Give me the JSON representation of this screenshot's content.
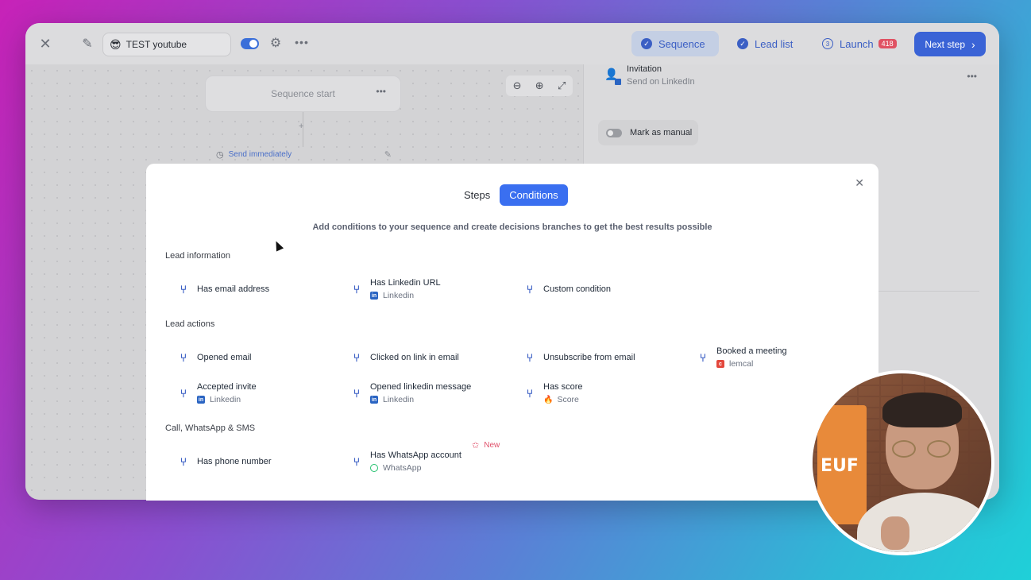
{
  "topbar": {
    "sequence_name": "TEST youtube",
    "name_emoji": "😎",
    "tabs": [
      {
        "label": "Sequence"
      },
      {
        "label": "Lead list"
      },
      {
        "label": "Launch",
        "badge": "418"
      }
    ],
    "next_step_label": "Next step"
  },
  "canvas": {
    "sequence_start_label": "Sequence start",
    "send_immediately_label": "Send immediately"
  },
  "right_panel": {
    "step_title": "Invitation",
    "step_subtitle": "Send on LinkedIn",
    "mark_manual_label": "Mark as manual"
  },
  "modal": {
    "tabs": [
      {
        "label": "Steps"
      },
      {
        "label": "Conditions"
      }
    ],
    "subtitle": "Add conditions to your sequence and create decisions branches to get the best results possible",
    "sections": {
      "lead_information": {
        "title": "Lead information",
        "items": [
          {
            "label": "Has email address"
          },
          {
            "label": "Has Linkedin URL",
            "sub": "Linkedin"
          },
          {
            "label": "Custom condition"
          }
        ]
      },
      "lead_actions": {
        "title": "Lead actions",
        "items": [
          {
            "label": "Opened email"
          },
          {
            "label": "Clicked on link in email"
          },
          {
            "label": "Unsubscribe from email"
          },
          {
            "label": "Booked a meeting",
            "sub": "lemcal"
          },
          {
            "label": "Accepted invite",
            "sub": "Linkedin"
          },
          {
            "label": "Opened linkedin message",
            "sub": "Linkedin"
          },
          {
            "label": "Has score",
            "sub": "Score"
          }
        ]
      },
      "call_whatsapp_sms": {
        "title": "Call, WhatsApp & SMS",
        "items": [
          {
            "label": "Has phone number"
          },
          {
            "label": "Has WhatsApp account",
            "sub": "WhatsApp"
          }
        ],
        "new_badge": "New"
      }
    }
  },
  "colors": {
    "accent": "#3a6ff0",
    "branch_icon": "#3b5fc4",
    "linkedin": "#2a64c2",
    "badge": "#e05263"
  },
  "webcam": {
    "sign_text": "EUF"
  }
}
